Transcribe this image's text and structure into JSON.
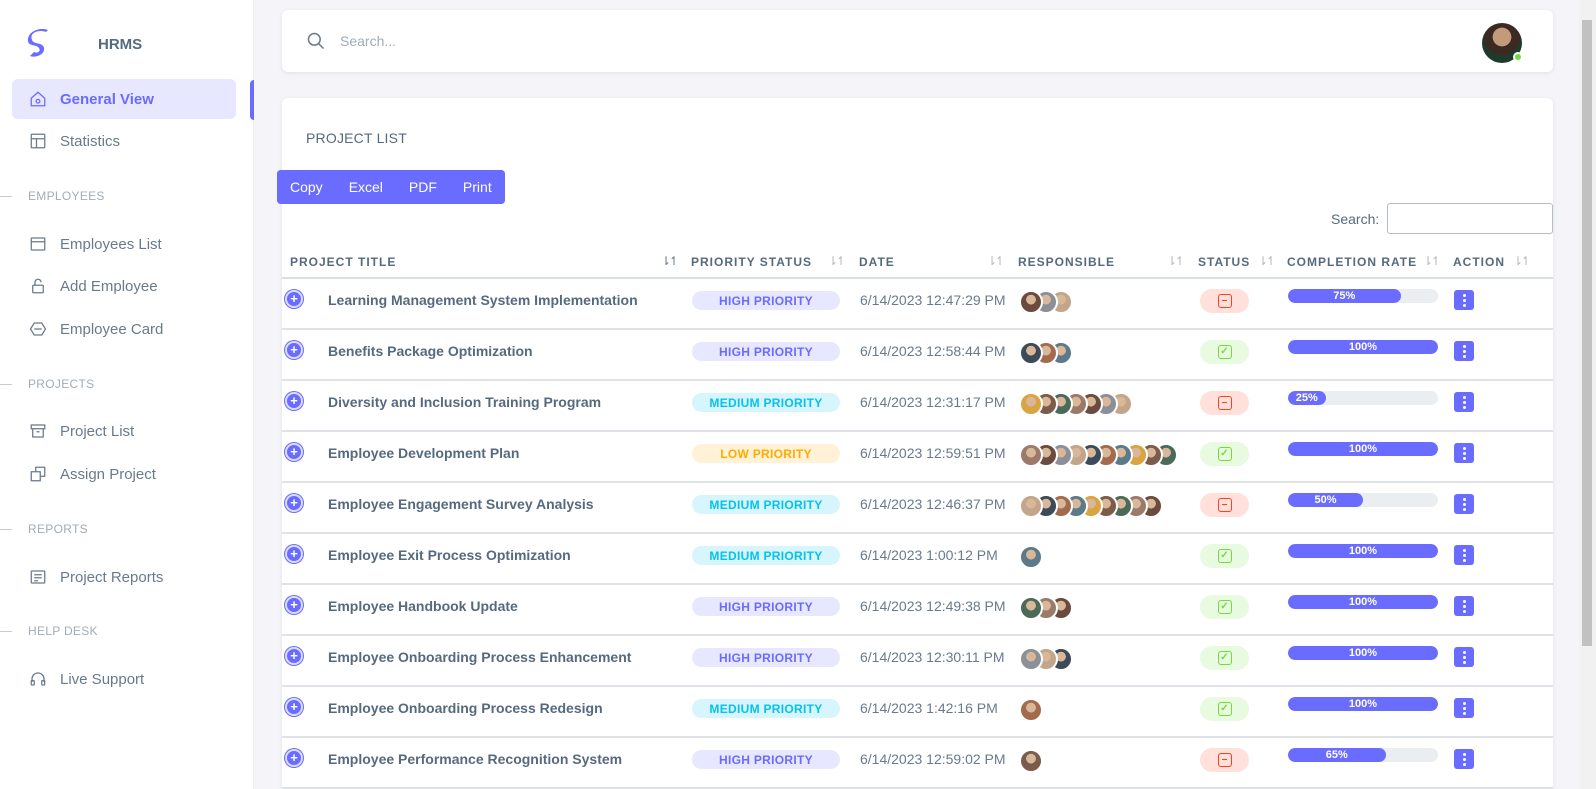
{
  "brand": {
    "name": "HRMS"
  },
  "navbar": {
    "search_placeholder": "Search..."
  },
  "sidebar": {
    "items": [
      {
        "label": "General View",
        "icon": "home-icon"
      },
      {
        "label": "Statistics",
        "icon": "layout-icon"
      },
      {
        "label": "Employees List",
        "icon": "window-icon"
      },
      {
        "label": "Add Employee",
        "icon": "lock-icon"
      },
      {
        "label": "Employee Card",
        "icon": "hexagon-icon"
      },
      {
        "label": "Project List",
        "icon": "archive-icon"
      },
      {
        "label": "Assign Project",
        "icon": "copy-icon"
      },
      {
        "label": "Project Reports",
        "icon": "report-icon"
      },
      {
        "label": "Live Support",
        "icon": "headphones-icon"
      }
    ],
    "headers": [
      "EMPLOYEES",
      "PROJECTS",
      "REPORTS",
      "HELP DESK"
    ]
  },
  "card": {
    "title": "PROJECT LIST",
    "buttons": [
      "Copy",
      "Excel",
      "PDF",
      "Print"
    ],
    "search_label": "Search:"
  },
  "table": {
    "headers": [
      "PROJECT TITLE",
      "PRIORITY STATUS",
      "DATE",
      "RESPONSIBLE",
      "STATUS",
      "COMPLETION RATE",
      "ACTION"
    ],
    "rows": [
      {
        "title": "Learning Management System Implementation",
        "priority": "HIGH PRIORITY",
        "level": "high",
        "date": "6/14/2023 12:47:29 PM",
        "avatars": 3,
        "status": "incomplete",
        "completion": 75,
        "completion_label": "75%"
      },
      {
        "title": "Benefits Package Optimization",
        "priority": "HIGH PRIORITY",
        "level": "high",
        "date": "6/14/2023 12:58:44 PM",
        "avatars": 3,
        "status": "complete",
        "completion": 100,
        "completion_label": "100%"
      },
      {
        "title": "Diversity and Inclusion Training Program",
        "priority": "MEDIUM PRIORITY",
        "level": "medium",
        "date": "6/14/2023 12:31:17 PM",
        "avatars": 7,
        "status": "incomplete",
        "completion": 25,
        "completion_label": "25%"
      },
      {
        "title": "Employee Development Plan",
        "priority": "LOW PRIORITY",
        "level": "low",
        "date": "6/14/2023 12:59:51 PM",
        "avatars": 10,
        "status": "complete",
        "completion": 100,
        "completion_label": "100%"
      },
      {
        "title": "Employee Engagement Survey Analysis",
        "priority": "MEDIUM PRIORITY",
        "level": "medium",
        "date": "6/14/2023 12:46:37 PM",
        "avatars": 9,
        "status": "incomplete",
        "completion": 50,
        "completion_label": "50%"
      },
      {
        "title": "Employee Exit Process Optimization",
        "priority": "MEDIUM PRIORITY",
        "level": "medium",
        "date": "6/14/2023 1:00:12 PM",
        "avatars": 1,
        "status": "complete",
        "completion": 100,
        "completion_label": "100%"
      },
      {
        "title": "Employee Handbook Update",
        "priority": "HIGH PRIORITY",
        "level": "high",
        "date": "6/14/2023 12:49:38 PM",
        "avatars": 3,
        "status": "complete",
        "completion": 100,
        "completion_label": "100%"
      },
      {
        "title": "Employee Onboarding Process Enhancement",
        "priority": "HIGH PRIORITY",
        "level": "high",
        "date": "6/14/2023 12:30:11 PM",
        "avatars": 3,
        "status": "complete",
        "completion": 100,
        "completion_label": "100%"
      },
      {
        "title": "Employee Onboarding Process Redesign",
        "priority": "MEDIUM PRIORITY",
        "level": "medium",
        "date": "6/14/2023 1:42:16 PM",
        "avatars": 1,
        "status": "complete",
        "completion": 100,
        "completion_label": "100%"
      },
      {
        "title": "Employee Performance Recognition System",
        "priority": "HIGH PRIORITY",
        "level": "high",
        "date": "6/14/2023 12:59:02 PM",
        "avatars": 1,
        "status": "incomplete",
        "completion": 65,
        "completion_label": "65%"
      }
    ]
  },
  "colors": {
    "primary": "#696cff",
    "success": "#71dd37",
    "danger": "#ff3e1d",
    "info": "#03c3ec",
    "warning": "#ffab00"
  }
}
